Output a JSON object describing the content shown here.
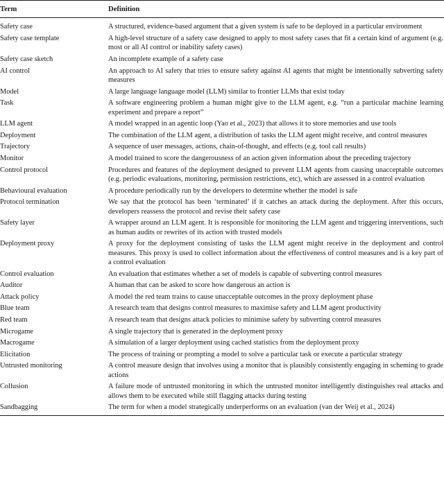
{
  "document": {
    "type": "glossary-table",
    "style": "booktabs",
    "rules": {
      "top": true,
      "header_separator": true,
      "bottom": true
    }
  },
  "table": {
    "columns": [
      {
        "key": "term",
        "header": "Term"
      },
      {
        "key": "definition",
        "header": "Definition"
      }
    ],
    "rows": [
      {
        "term": "Safety case",
        "definition": "A structured, evidence-based argument that a given system is safe to be deployed in a particular environment"
      },
      {
        "term": "Safety case template",
        "definition": "A high-level structure of a safety case designed to apply to most safety cases that fit a certain kind of argument (e.g. most or all AI control or inability safety cases)"
      },
      {
        "term": "Safety case sketch",
        "definition": "An incomplete example of a safety case"
      },
      {
        "term": "AI control",
        "definition": "An approach to AI safety that tries to ensure safety against AI agents that might be intentionally subverting safety measures"
      },
      {
        "term": "Model",
        "definition": "A large language language model (LLM) similar to frontier LLMs that exist today"
      },
      {
        "term": "Task",
        "definition": "A software engineering problem a human might give to the LLM agent, e.g. “run a particular machine learning experiment and prepare a report”"
      },
      {
        "term": "LLM agent",
        "definition": "A model wrapped in an agentic loop (Yao et al., 2023) that allows it to store memories and use tools"
      },
      {
        "term": "Deployment",
        "definition": "The combination of the LLM agent, a distribution of tasks the LLM agent might receive, and control measures"
      },
      {
        "term": "Trajectory",
        "definition": "A sequence of user messages, actions, chain-of-thought, and effects (e.g. tool call results)"
      },
      {
        "term": "Monitor",
        "definition": "A model trained to score the dangerousness of an action given information about the preceding trajectory"
      },
      {
        "term": "Control protocol",
        "definition": "Procedures and features of the deployment designed to prevent LLM agents from causing unacceptable outcomes (e.g. periodic evaluations, monitoring, permission restrictions, etc), which are assessed in a control evaluation"
      },
      {
        "term": "Behavioural evaluation",
        "definition": "A procedure periodically run by the developers to determine whether the model is safe"
      },
      {
        "term": "Protocol termination",
        "definition": "We say that the protocol has been ‘terminated’ if it catches an attack during the deployment. After this occurs, developers reassess the protocol and revise their safety case"
      },
      {
        "term": "Safety layer",
        "definition": "A wrapper around an LLM agent. It is responsible for monitoring the LLM agent and triggering interventions, such as human audits or rewrites of its action with trusted models"
      },
      {
        "term": "Deployment proxy",
        "definition": "A proxy for the deployment consisting of tasks the LLM agent might receive in the deployment and control measures. This proxy is used to collect information about the effectiveness of control measures and is a key part of a control evaluation"
      },
      {
        "term": "Control evaluation",
        "definition": "An evaluation that estimates whether a set of models is capable of subverting control measures"
      },
      {
        "term": "Auditor",
        "definition": "A human that can be asked to score how dangerous an action is"
      },
      {
        "term": "Attack policy",
        "definition": "A model the red team trains to cause unacceptable outcomes in the proxy deployment phase"
      },
      {
        "term": "Blue team",
        "definition": "A research team that designs control measures to maximise safety and LLM agent productivity"
      },
      {
        "term": "Red team",
        "definition": "A research team that designs attack policies to minimise safety by subverting control measures"
      },
      {
        "term": "Microgame",
        "definition": "A single trajectory that is generated in the deployment proxy"
      },
      {
        "term": "Macrogame",
        "definition": "A simulation of a larger deployment using cached statistics from the deployment proxy"
      },
      {
        "term": "Elicitation",
        "definition": "The process of training or prompting a model to solve a particular task or execute a particular strategy"
      },
      {
        "term": "Untrusted monitoring",
        "definition": "A control measure design that involves using a monitor that is plausibly consistently engaging in scheming to grade actions"
      },
      {
        "term": "Collusion",
        "definition": "A failure mode of untrusted monitoring in which the untrusted monitor intelligently distinguishes real attacks and allows them to be executed while still flagging attacks during testing"
      },
      {
        "term": "Sandbagging",
        "definition": "The term for when a model strategically underperforms on an evaluation (van der Weij et al., 2024)"
      }
    ]
  },
  "colors": {
    "text": "#1a1a1a",
    "rule": "#1a1a1a",
    "background": "#ffffff"
  }
}
